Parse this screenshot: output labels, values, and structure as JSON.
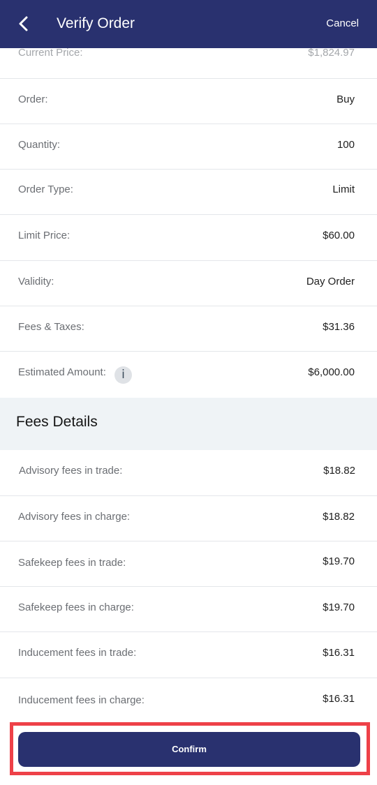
{
  "header": {
    "title": "Verify Order",
    "cancel_label": "Cancel"
  },
  "order_details": [
    {
      "label": "Current Price:",
      "value": "$1,824.97"
    },
    {
      "label": "Order:",
      "value": "Buy"
    },
    {
      "label": "Quantity:",
      "value": "100"
    },
    {
      "label": "Order Type:",
      "value": "Limit"
    },
    {
      "label": "Limit Price:",
      "value": "$60.00"
    },
    {
      "label": "Validity:",
      "value": "Day Order"
    },
    {
      "label": "Fees & Taxes:",
      "value": "$31.36"
    },
    {
      "label": "Estimated Amount:",
      "value": "$6,000.00",
      "info_icon": "i"
    }
  ],
  "fees_details": {
    "title": "Fees Details",
    "rows": [
      {
        "label": "Advisory fees in trade:",
        "value": "$18.82"
      },
      {
        "label": "Advisory fees in charge:",
        "value": "$18.82"
      },
      {
        "label": "Safekeep fees in trade:",
        "value": "$19.70"
      },
      {
        "label": "Safekeep fees in charge:",
        "value": "$19.70"
      },
      {
        "label": "Inducement fees in trade:",
        "value": "$16.31"
      },
      {
        "label": "Inducement fees in charge:",
        "value": "$16.31"
      }
    ]
  },
  "footer": {
    "confirm_label": "Confirm"
  },
  "icons": {
    "back": "back-arrow-icon",
    "info": "info-icon"
  },
  "colors": {
    "header_bg": "#29316f",
    "button_bg": "#29316f",
    "highlight_border": "#ee4148",
    "section_bg": "#eff3f6"
  }
}
